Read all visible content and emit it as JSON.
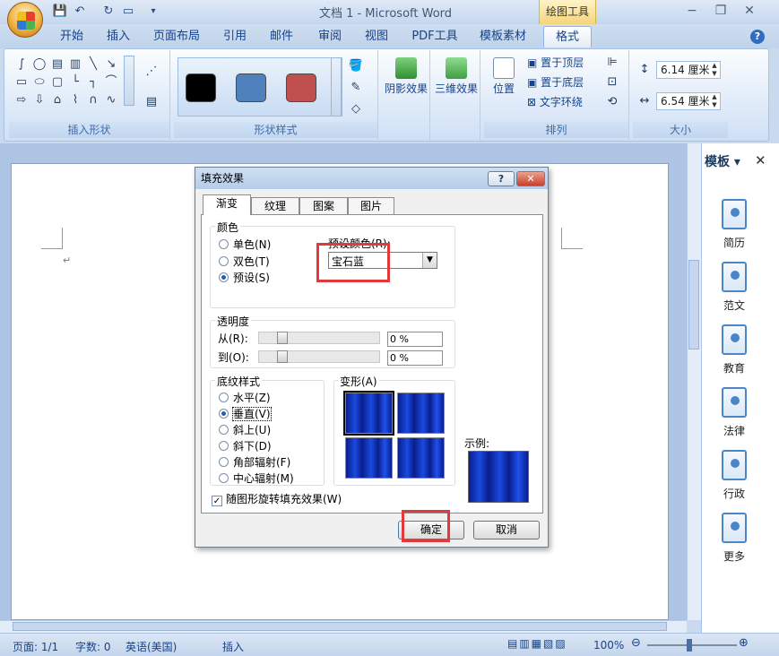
{
  "window": {
    "title": "文档 1 - Microsoft Word",
    "tool_context": "绘图工具",
    "minimize": "−",
    "maximize": "❐",
    "close": "✕"
  },
  "tabs": [
    "开始",
    "插入",
    "页面布局",
    "引用",
    "邮件",
    "审阅",
    "视图",
    "PDF工具",
    "模板素材",
    "格式"
  ],
  "active_tab": "格式",
  "ribbon": {
    "groups": {
      "insert_shapes": "插入形状",
      "shape_styles": "形状样式",
      "arrange": "排列",
      "size": "大小"
    },
    "shadow_effect": "阴影效果",
    "effects_3d": "三维效果",
    "position": "位置",
    "bring_to_front": "置于顶层",
    "send_to_back": "置于底层",
    "text_wrap": "文字环绕",
    "height": "6.14 厘米",
    "width": "6.54 厘米",
    "swatch_colors": [
      "#000000",
      "#4f81bd",
      "#c0504d"
    ]
  },
  "pane": {
    "title": "模板",
    "items": [
      "简历",
      "范文",
      "教育",
      "法律",
      "行政",
      "更多"
    ]
  },
  "status": {
    "page": "页面: 1/1",
    "words": "字数: 0",
    "language": "英语(美国)",
    "mode": "插入",
    "zoom": "100%"
  },
  "dialog": {
    "title": "填充效果",
    "help": "?",
    "close": "✕",
    "tabs": [
      "渐变",
      "纹理",
      "图案",
      "图片"
    ],
    "active_tab": "渐变",
    "color_group": "颜色",
    "color_options": [
      "单色(N)",
      "双色(T)",
      "预设(S)"
    ],
    "color_selected": "预设(S)",
    "preset_label": "预设颜色(R):",
    "preset_value": "宝石蓝",
    "transparency_group": "透明度",
    "from_label": "从(R):",
    "to_label": "到(O):",
    "from_value": "0 %",
    "to_value": "0 %",
    "shading_group": "底纹样式",
    "shading_options": [
      "水平(Z)",
      "垂直(V)",
      "斜上(U)",
      "斜下(D)",
      "角部辐射(F)",
      "中心辐射(M)"
    ],
    "shading_selected": "垂直(V)",
    "variants_group": "变形(A)",
    "sample_label": "示例:",
    "rotate_checkbox": "随图形旋转填充效果(W)",
    "rotate_checked": true,
    "ok": "确定",
    "cancel": "取消"
  }
}
